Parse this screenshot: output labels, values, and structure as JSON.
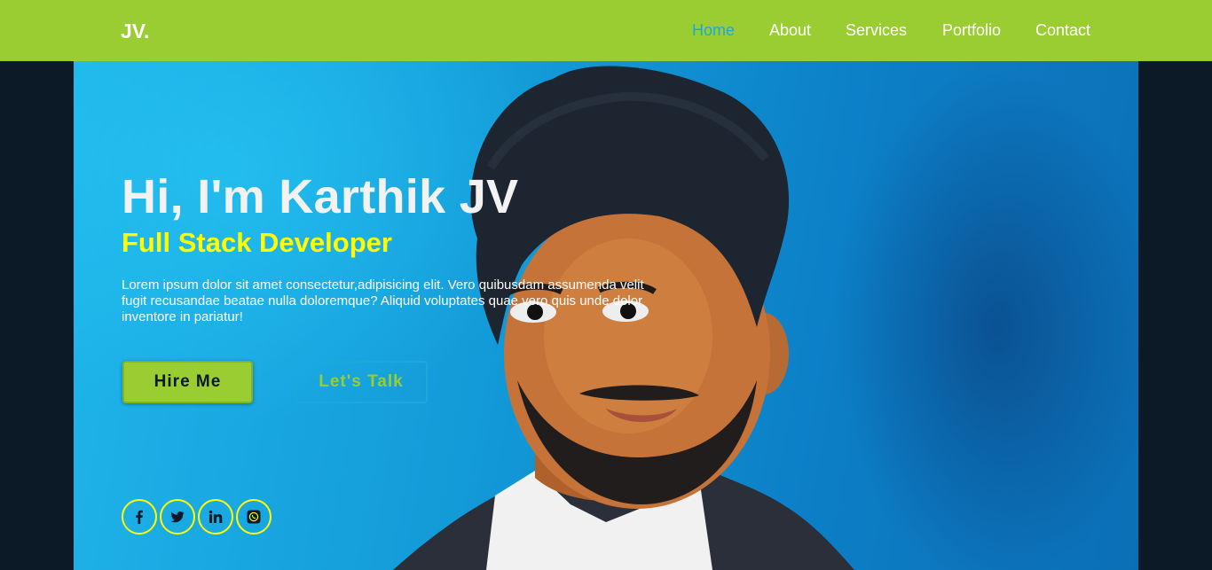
{
  "brand": {
    "logo": "JV."
  },
  "nav": {
    "items": [
      {
        "label": "Home",
        "active": true
      },
      {
        "label": "About"
      },
      {
        "label": "Services"
      },
      {
        "label": "Portfolio"
      },
      {
        "label": "Contact"
      }
    ]
  },
  "hero": {
    "title": "Hi, I'm Karthik JV",
    "subtitle": "Full Stack Developer",
    "description": "Lorem ipsum dolor sit amet consectetur,adipisicing elit. Vero quibusdam assumenda velit fugit recusandae beatae nulla doloremque? Aliquid voluptates quae vero quis unde dolor inventore in pariatur!",
    "buttons": {
      "hire": "Hire Me",
      "talk": "Let's Talk"
    },
    "socials": [
      "facebook-icon",
      "twitter-icon",
      "linkedin-icon",
      "whatsapp-icon"
    ]
  },
  "colors": {
    "navbar": "#9acd32",
    "active_link": "#1ba9dc",
    "subtitle": "#ffff00",
    "page_bg": "#0b1a26"
  }
}
